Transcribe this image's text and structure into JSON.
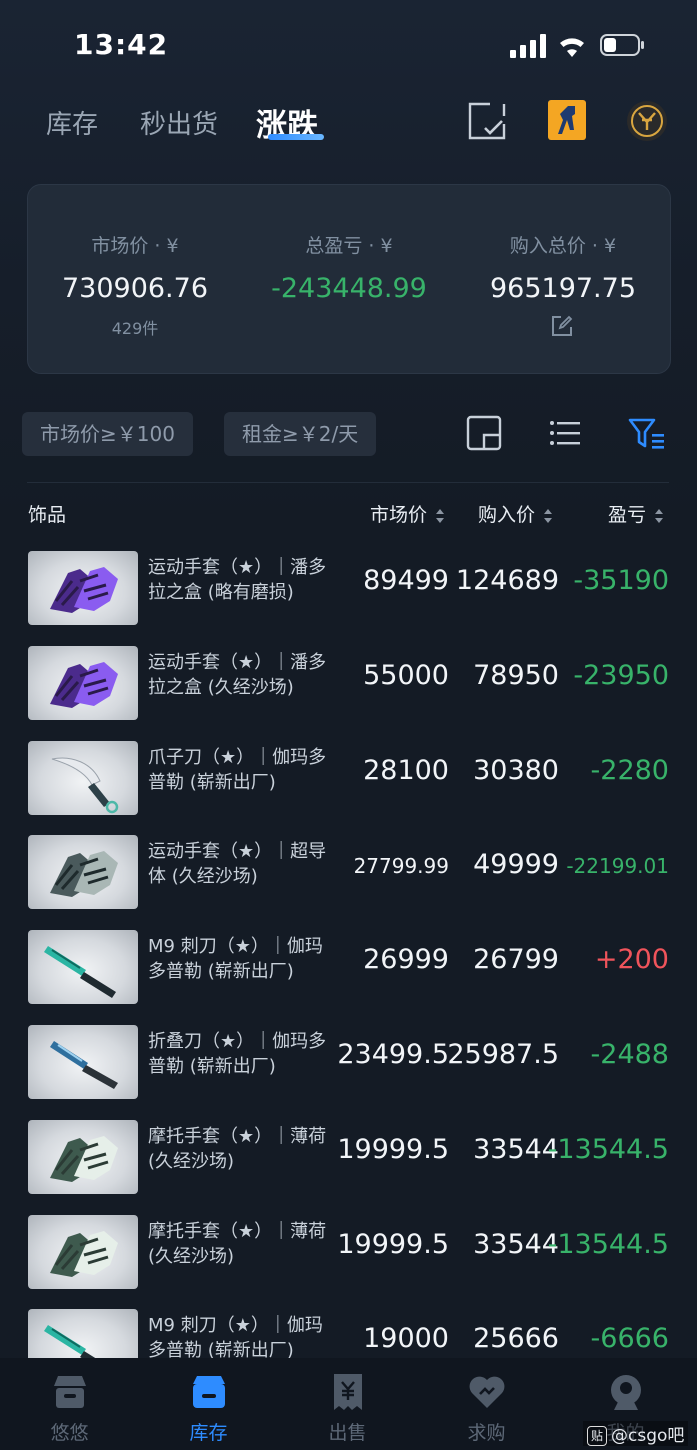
{
  "status_bar": {
    "time": "13:42"
  },
  "top_tabs": [
    {
      "label": "库存",
      "active": false
    },
    {
      "label": "秒出货",
      "active": false
    },
    {
      "label": "涨跌",
      "active": true
    }
  ],
  "summary": {
    "market_label": "市场价 · ¥",
    "market_value": "730906.76",
    "market_count": "429件",
    "profit_label": "总盈亏 · ¥",
    "profit_value": "-243448.99",
    "cost_label": "购入总价 · ¥",
    "cost_value": "965197.75"
  },
  "filters": {
    "chip_market": "市场价≥￥100",
    "chip_rent": "租金≥￥2/天"
  },
  "table": {
    "headers": {
      "item": "饰品",
      "market": "市场价",
      "buy": "购入价",
      "pl": "盈亏"
    },
    "rows": [
      {
        "name": "运动手套（★）｜潘多拉之盒 (略有磨损)",
        "market": "89499",
        "buy": "124689",
        "pl": "-35190",
        "thumb": "glove-purple"
      },
      {
        "name": "运动手套（★）｜潘多拉之盒 (久经沙场)",
        "market": "55000",
        "buy": "78950",
        "pl": "-23950",
        "thumb": "glove-purple"
      },
      {
        "name": "爪子刀（★）｜伽玛多普勒 (崭新出厂)",
        "market": "28100",
        "buy": "30380",
        "pl": "-2280",
        "thumb": "karambit"
      },
      {
        "name": "运动手套（★）｜超导体 (久经沙场)",
        "market": "27799.99",
        "buy": "49999",
        "pl": "-22199.01",
        "thumb": "glove-grey"
      },
      {
        "name": "M9 刺刀（★）｜伽玛多普勒 (崭新出厂)",
        "market": "26999",
        "buy": "26799",
        "pl": "+200",
        "thumb": "m9"
      },
      {
        "name": "折叠刀（★）｜伽玛多普勒 (崭新出厂)",
        "market": "23499.5",
        "buy": "25987.5",
        "pl": "-2488",
        "thumb": "flip"
      },
      {
        "name": "摩托手套（★）｜薄荷 (久经沙场)",
        "market": "19999.5",
        "buy": "33544",
        "pl": "-13544.5",
        "thumb": "glove-mint"
      },
      {
        "name": "摩托手套（★）｜薄荷 (久经沙场)",
        "market": "19999.5",
        "buy": "33544",
        "pl": "-13544.5",
        "thumb": "glove-mint"
      },
      {
        "name": "M9 刺刀（★）｜伽玛多普勒 (崭新出厂)",
        "market": "19000",
        "buy": "25666",
        "pl": "-6666",
        "thumb": "m9"
      }
    ]
  },
  "bottom_nav": [
    {
      "label": "悠悠",
      "active": false,
      "icon": "store-icon"
    },
    {
      "label": "库存",
      "active": true,
      "icon": "inventory-icon"
    },
    {
      "label": "出售",
      "active": false,
      "icon": "sell-icon"
    },
    {
      "label": "求购",
      "active": false,
      "icon": "wish-icon"
    },
    {
      "label": "我的",
      "active": false,
      "icon": "profile-icon"
    }
  ],
  "watermark": "@csgo吧",
  "colors": {
    "accent": "#2e8cff",
    "loss": "#38b36a",
    "gain": "#f0545b",
    "background": "#141b25"
  }
}
